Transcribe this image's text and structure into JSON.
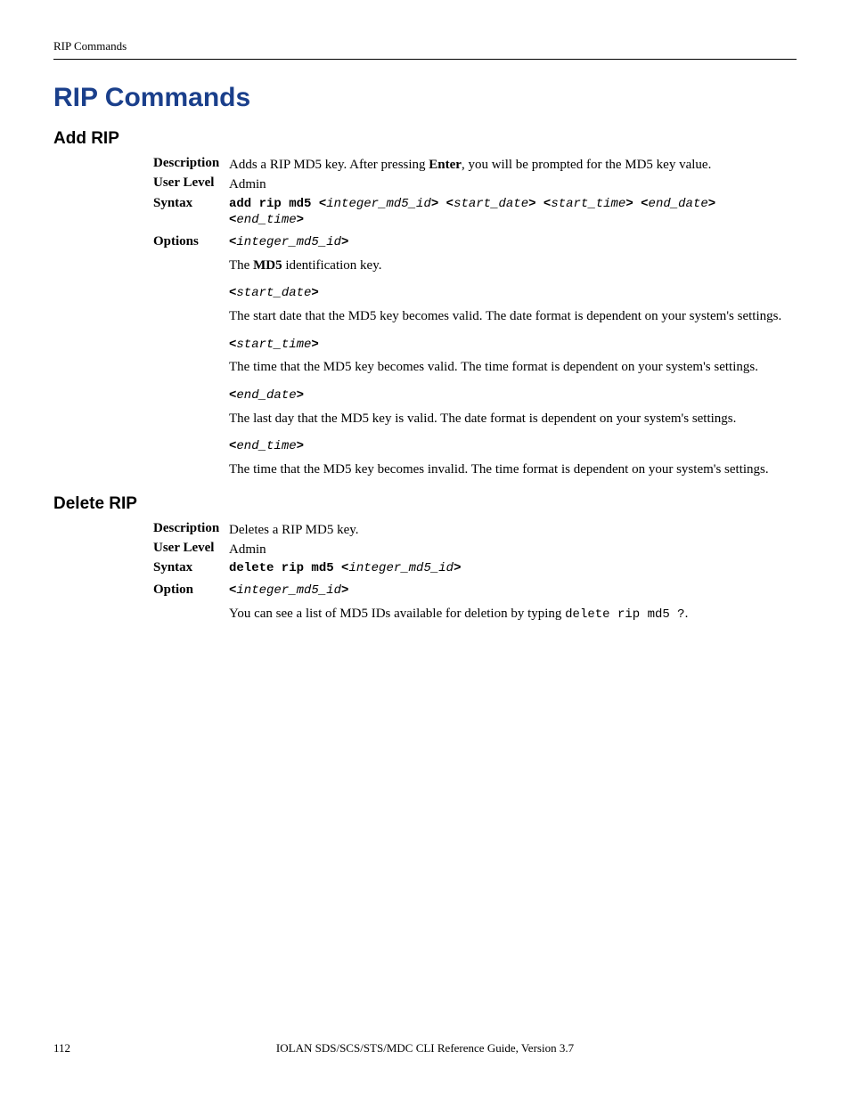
{
  "header": {
    "running": "RIP Commands"
  },
  "title": "RIP Commands",
  "sections": {
    "add": {
      "heading": "Add RIP",
      "description_label": "Description",
      "description_pre": "Adds a RIP MD5 key. After pressing ",
      "description_bold": "Enter",
      "description_post": ", you will be prompted for the MD5 key value.",
      "userlevel_label": "User Level",
      "userlevel": "Admin",
      "syntax_label": "Syntax",
      "syntax": {
        "cmd": "add rip md5",
        "params": [
          "integer_md5_id",
          "start_date",
          "start_time",
          "end_date",
          "end_time"
        ]
      },
      "options_label": "Options",
      "options": [
        {
          "param": "integer_md5_id",
          "desc_pre": "The ",
          "desc_bold": "MD5",
          "desc_post": " identification key."
        },
        {
          "param": "start_date",
          "desc": "The start date that the MD5 key becomes valid. The date format is dependent on your system's settings."
        },
        {
          "param": "start_time",
          "desc": "The time that the MD5 key becomes valid. The time format is dependent on your system's settings."
        },
        {
          "param": "end_date",
          "desc": "The last day that the MD5 key is valid. The date format is dependent on your system's settings."
        },
        {
          "param": "end_time",
          "desc": "The time that the MD5 key becomes invalid. The time format is dependent on your system's settings."
        }
      ]
    },
    "delete": {
      "heading": "Delete RIP",
      "description_label": "Description",
      "description": "Deletes a RIP MD5 key.",
      "userlevel_label": "User Level",
      "userlevel": "Admin",
      "syntax_label": "Syntax",
      "syntax": {
        "cmd": "delete rip md5",
        "params": [
          "integer_md5_id"
        ]
      },
      "option_label": "Option",
      "option": {
        "param": "integer_md5_id",
        "desc_pre": "You can see a list of MD5 IDs available for deletion by typing ",
        "desc_mono": "delete rip md5 ?",
        "desc_post": "."
      }
    }
  },
  "footer": {
    "page": "112",
    "title": "IOLAN SDS/SCS/STS/MDC CLI Reference Guide, Version 3.7"
  }
}
